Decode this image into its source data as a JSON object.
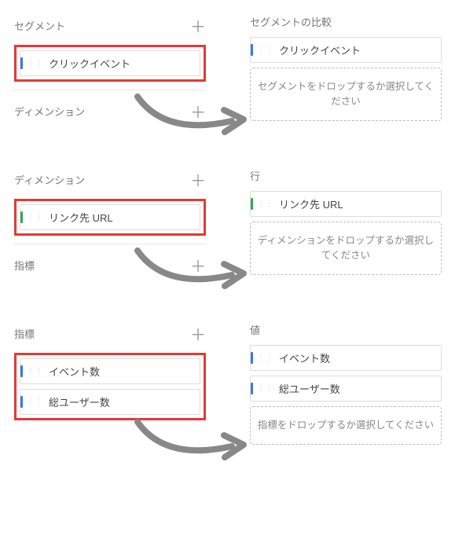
{
  "section1": {
    "sourceLabel": "セグメント",
    "chips": [
      "クリックイベント"
    ],
    "nextLabel": "ディメンション",
    "targetLabel": "セグメントの比較",
    "targetChips": [
      "クリックイベント"
    ],
    "dropText": "セグメントをドロップするか選択してください"
  },
  "section2": {
    "sourceLabel": "ディメンション",
    "chips": [
      "リンク先 URL"
    ],
    "nextLabel": "指標",
    "targetLabel": "行",
    "targetChips": [
      "リンク先 URL"
    ],
    "dropText": "ディメンションをドロップするか選択してください"
  },
  "section3": {
    "sourceLabel": "指標",
    "chips": [
      "イベント数",
      "総ユーザー数"
    ],
    "targetLabel": "値",
    "targetChips": [
      "イベント数",
      "総ユーザー数"
    ],
    "dropText": "指標をドロップするか選択してください"
  }
}
